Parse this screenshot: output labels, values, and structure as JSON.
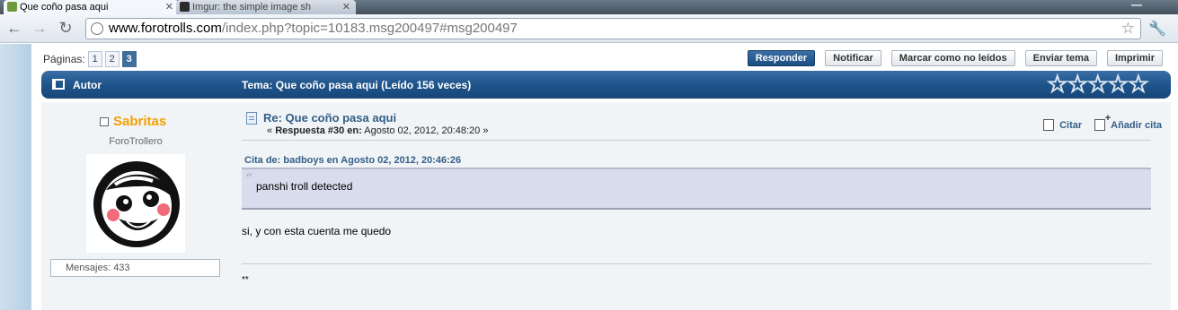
{
  "browser": {
    "tabs": [
      {
        "label": "Que coño pasa aqui",
        "active": true
      },
      {
        "label": "Imgur: the simple image sh",
        "active": false
      }
    ],
    "url_domain": "www.forotrolls.com",
    "url_path": "/index.php?topic=10183.msg200497#msg200497"
  },
  "pagination": {
    "label": "Páginas:",
    "pages": [
      "1",
      "2",
      "3"
    ],
    "current": "3"
  },
  "actions": {
    "reply": "Responder",
    "notify": "Notificar",
    "mark_unread": "Marcar como no leídos",
    "send_topic": "Enviar tema",
    "print": "Imprimir"
  },
  "header": {
    "author_label": "Autor",
    "topic_title": "Tema: Que coño pasa aqui  (Leído 156 veces)",
    "rating_stars": 5
  },
  "post": {
    "author": "Sabritas",
    "rank": "ForoTrollero",
    "messages": "Mensajes: 433",
    "subject": "Re: Que coño pasa aqui",
    "meta_prefix": "« ",
    "meta_bold": "Respuesta #30 en:",
    "meta_date": " Agosto 02, 2012, 20:48:20 »",
    "quote_action": "Citar",
    "add_quote_action": "Añadir cita",
    "quote_header": "Cita de: badboys en Agosto 02, 2012, 20:46:26",
    "quote_text": "panshi troll detected",
    "body": "si, y con esta cuenta me quedo",
    "signature": "**"
  },
  "colors": {
    "accent": "#1f548b",
    "author_name": "#f4a000",
    "quote_bg": "#d8dcec"
  }
}
